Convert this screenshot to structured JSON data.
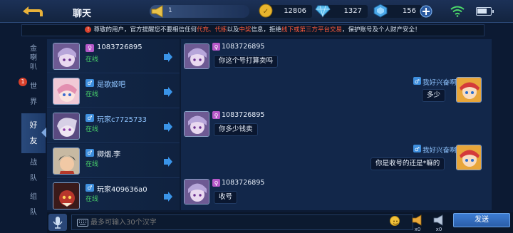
{
  "header": {
    "title": "聊天",
    "horn_text": "1",
    "gold": "12806",
    "diamonds": "1327",
    "coupons": "156"
  },
  "notice": {
    "part1": "尊敬的用户，官方提醒您不要相信任何",
    "red1": "代充、代练",
    "part2": "以及",
    "red2": "中奖",
    "part3": "信息，拒绝",
    "red3": "线下或第三方平台交易",
    "part4": "，保护账号及个人财产安全！"
  },
  "tabs": [
    {
      "label": "金\n喇\n叭"
    },
    {
      "label": "世\n界",
      "badge": "1"
    },
    {
      "label": "好\n友"
    },
    {
      "label": "战\n队"
    },
    {
      "label": "组\n队"
    }
  ],
  "friends": [
    {
      "name": "1083726895",
      "status": "在线",
      "gender": "female"
    },
    {
      "name": "是歌姬吧",
      "status": "在线",
      "gender": "male"
    },
    {
      "name": "玩家c7725733",
      "status": "在线",
      "gender": "male"
    },
    {
      "name": "卿烟.李",
      "status": "在线",
      "gender": "male"
    },
    {
      "name": "玩家409636a0",
      "status": "在线",
      "gender": "male"
    }
  ],
  "messages": [
    {
      "sender": "1083726895",
      "text": "你这个号打算卖吗",
      "self": false
    },
    {
      "sender": "我好兴奋啊",
      "text": "多少",
      "self": true
    },
    {
      "sender": "1083726895",
      "text": "你多少钱卖",
      "self": false
    },
    {
      "sender": "我好兴奋啊",
      "text": "你是收号的还是*嘛的",
      "self": true
    },
    {
      "sender": "1083726895",
      "text": "收号",
      "self": false
    }
  ],
  "input": {
    "placeholder": "最多可输入30个汉字",
    "horn1_count": "x0",
    "horn2_count": "x0",
    "send_label": "发送"
  },
  "colors": {
    "accent": "#3d7dd3",
    "online": "#48d06a",
    "warning": "#ff5a3a"
  }
}
